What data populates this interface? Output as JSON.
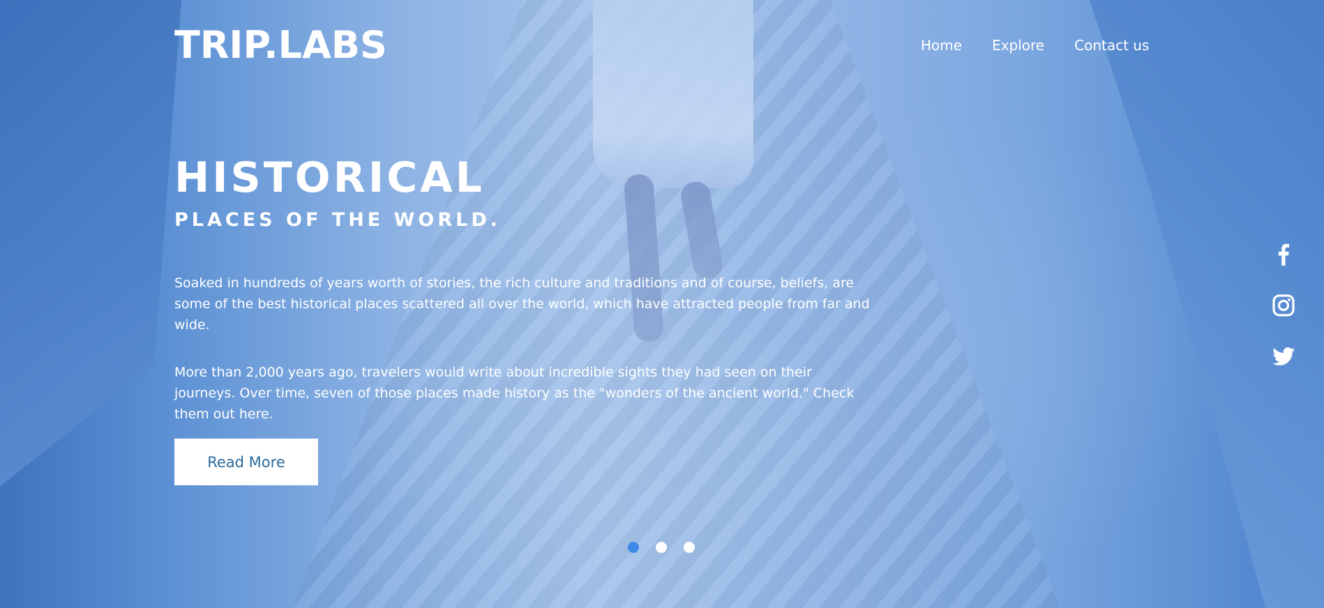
{
  "brand": {
    "logo_text": "TRIP.LABS"
  },
  "nav": {
    "items": [
      {
        "label": "Home"
      },
      {
        "label": "Explore"
      },
      {
        "label": "Contact us"
      }
    ]
  },
  "hero": {
    "title": "HISTORICAL",
    "subtitle": "PLACES OF THE WORLD.",
    "paragraphs": [
      "Soaked in hundreds of years worth of stories, the rich culture and traditions and of course, beliefs, are some of the best historical places scattered all over the world, which have attracted people from far and wide.",
      "More than 2,000 years ago, travelers would write about incredible sights they had seen on their journeys. Over time, seven of those places made history as the \"wonders of the ancient world.\" Check them out here."
    ],
    "button_label": "Read More"
  },
  "social": {
    "icons": [
      "facebook-icon",
      "instagram-icon",
      "twitter-icon"
    ]
  },
  "slider": {
    "total": 3,
    "active_index": 0
  },
  "colors": {
    "button_text": "#2a6b9c",
    "active_dot": "#3a8ae6",
    "text": "#ffffff"
  }
}
